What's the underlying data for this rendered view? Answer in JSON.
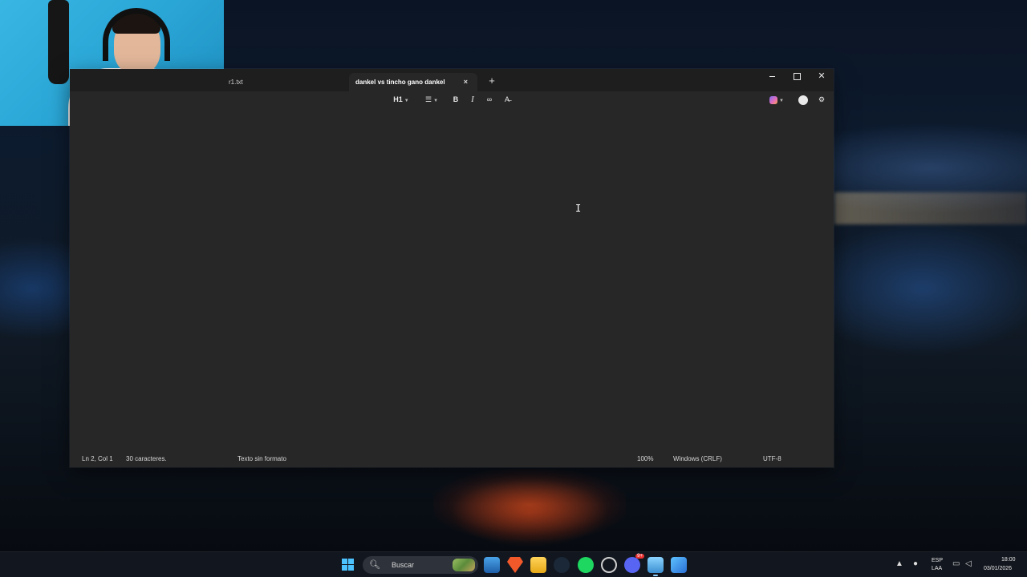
{
  "webcam": {
    "label": ""
  },
  "window": {
    "tabs": [
      {
        "label": "r1.txt",
        "active": false
      },
      {
        "label": "dankel vs tincho gano dankel",
        "active": true
      }
    ],
    "tab_close_glyph": "×",
    "new_tab_glyph": "+",
    "controls": {
      "minimize": "",
      "maximize": "",
      "close": "✕"
    }
  },
  "toolbar": {
    "heading": "H1",
    "list": "☰",
    "bold": "B",
    "italic": "I",
    "link": "∞",
    "clear_format": "A̶",
    "settings": "⚙"
  },
  "editor": {
    "content": ""
  },
  "statusbar": {
    "position": "Ln 2, Col 1",
    "characters": "30 caracteres.",
    "format": "Texto sin formato",
    "zoom": "100%",
    "line_endings": "Windows (CRLF)",
    "encoding": "UTF-8"
  },
  "taskbar": {
    "search_placeholder": "Buscar",
    "language_top": "ESP",
    "language_bottom": "LAA",
    "time": "18:00",
    "date": "03/01/2026",
    "discord_badge": "9+"
  },
  "colors": {
    "window_bg": "#272727",
    "titlebar_bg": "#1e1e1e",
    "accent": "#4cc2ff"
  }
}
